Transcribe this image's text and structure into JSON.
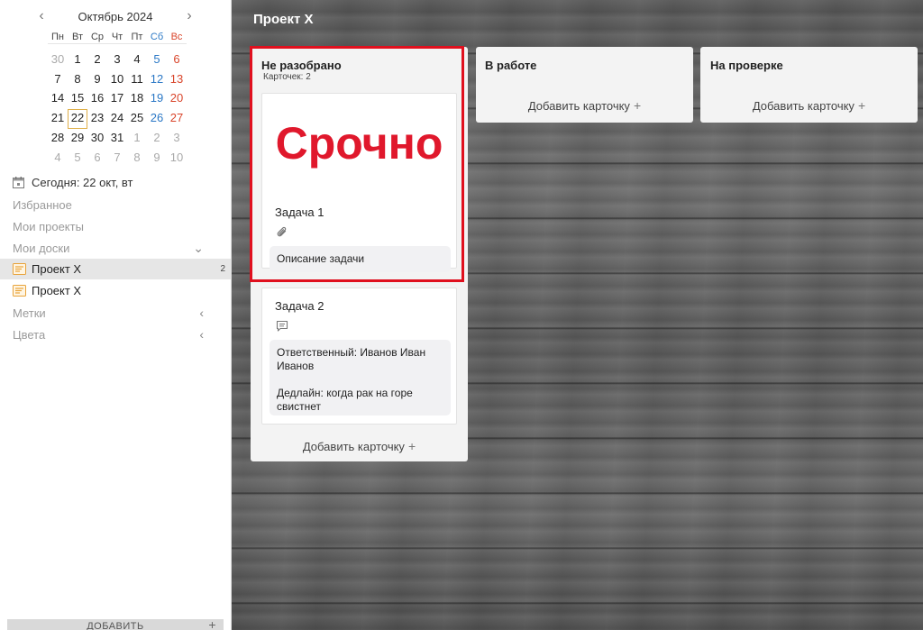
{
  "calendar": {
    "month_title": "Октябрь 2024",
    "prev_icon": "chevron-left-icon",
    "next_icon": "chevron-right-icon",
    "weekdays": [
      "Пн",
      "Вт",
      "Ср",
      "Чт",
      "Пт",
      "Сб",
      "Вс"
    ],
    "weeks": [
      [
        "30",
        "1",
        "2",
        "3",
        "4",
        "5",
        "6"
      ],
      [
        "7",
        "8",
        "9",
        "10",
        "11",
        "12",
        "13"
      ],
      [
        "14",
        "15",
        "16",
        "17",
        "18",
        "19",
        "20"
      ],
      [
        "21",
        "22",
        "23",
        "24",
        "25",
        "26",
        "27"
      ],
      [
        "28",
        "29",
        "30",
        "31",
        "1",
        "2",
        "3"
      ],
      [
        "4",
        "5",
        "6",
        "7",
        "8",
        "9",
        "10"
      ]
    ],
    "selected_day": "22"
  },
  "sidebar": {
    "today_label": "Сегодня: 22 окт, вт",
    "favorites": "Избранное",
    "my_projects": "Мои проекты",
    "my_boards": "Мои доски",
    "boards": [
      {
        "label": "Проект X",
        "count": "2"
      },
      {
        "label": "Проект X",
        "count": ""
      }
    ],
    "tags": "Метки",
    "colors": "Цвета",
    "add_button": "ДОБАВИТЬ"
  },
  "board": {
    "title": "Проект X",
    "columns": [
      {
        "title": "Не разобрано",
        "count_label": "Карточек: 2",
        "add_label": "Добавить карточку"
      },
      {
        "title": "В работе",
        "add_label": "Добавить карточку"
      },
      {
        "title": "На проверке",
        "add_label": "Добавить карточку"
      }
    ],
    "cards": [
      {
        "cover_text": "Срочно",
        "title": "Задача 1",
        "icon": "paperclip-icon",
        "description": "Описание задачи"
      },
      {
        "title": "Задача 2",
        "icon": "comment-icon",
        "description_lines": [
          "Ответственный: Иванов Иван Иванов",
          "Дедлайн: когда рак на горе свистнет"
        ]
      }
    ]
  },
  "colors": {
    "highlight": "#e0101e",
    "cover_text": "#e0182c",
    "saturday": "#2b78c6",
    "sunday": "#d9452b",
    "today_border": "#e0b04a",
    "board_icon": "#e8a33a"
  }
}
